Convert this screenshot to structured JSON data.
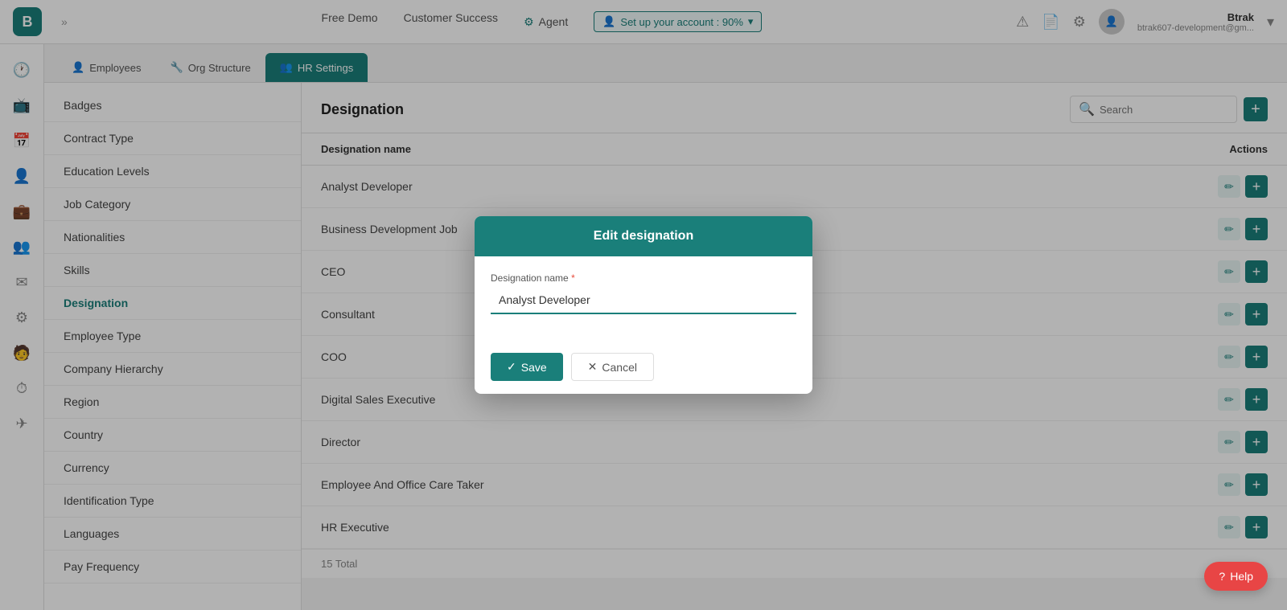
{
  "navbar": {
    "logo_text": "B",
    "chevron": "»",
    "links": [
      {
        "label": "Free Demo"
      },
      {
        "label": "Customer Success"
      },
      {
        "label": "Agent",
        "has_icon": true
      },
      {
        "label": "Set up your account : 90%",
        "has_icon": true,
        "has_chevron": true
      }
    ],
    "user": {
      "name": "Btrak",
      "email": "btrak607-development@gm..."
    }
  },
  "tabs": [
    {
      "label": "Employees",
      "icon": "👤",
      "active": false
    },
    {
      "label": "Org Structure",
      "icon": "🔧",
      "active": false
    },
    {
      "label": "HR Settings",
      "icon": "👥",
      "active": true
    }
  ],
  "sidebar_icons": [
    {
      "name": "clock-icon",
      "symbol": "🕐"
    },
    {
      "name": "tv-icon",
      "symbol": "📺"
    },
    {
      "name": "calendar-icon",
      "symbol": "📅"
    },
    {
      "name": "person-icon",
      "symbol": "👤"
    },
    {
      "name": "briefcase-icon",
      "symbol": "💼"
    },
    {
      "name": "people-icon",
      "symbol": "👥"
    },
    {
      "name": "mail-icon",
      "symbol": "✉"
    },
    {
      "name": "settings-icon",
      "symbol": "⚙"
    },
    {
      "name": "user2-icon",
      "symbol": "🧑"
    },
    {
      "name": "timer-icon",
      "symbol": "⏱"
    },
    {
      "name": "send-icon",
      "symbol": "✈"
    }
  ],
  "left_menu": {
    "items": [
      {
        "label": "Badges",
        "active": false
      },
      {
        "label": "Contract Type",
        "active": false
      },
      {
        "label": "Education Levels",
        "active": false
      },
      {
        "label": "Job Category",
        "active": false
      },
      {
        "label": "Nationalities",
        "active": false
      },
      {
        "label": "Skills",
        "active": false
      },
      {
        "label": "Designation",
        "active": true
      },
      {
        "label": "Employee Type",
        "active": false
      },
      {
        "label": "Company Hierarchy",
        "active": false
      },
      {
        "label": "Region",
        "active": false
      },
      {
        "label": "Country",
        "active": false
      },
      {
        "label": "Currency",
        "active": false
      },
      {
        "label": "Identification Type",
        "active": false
      },
      {
        "label": "Languages",
        "active": false
      },
      {
        "label": "Pay Frequency",
        "active": false
      }
    ]
  },
  "main_content": {
    "title": "Designation",
    "search_placeholder": "Search",
    "table": {
      "col_name": "Designation name",
      "col_actions": "Actions",
      "rows": [
        {
          "name": "Analyst Developer"
        },
        {
          "name": "Business Development Job"
        },
        {
          "name": "CEO"
        },
        {
          "name": "Consultant"
        },
        {
          "name": "COO"
        },
        {
          "name": "Digital Sales Executive"
        },
        {
          "name": "Director"
        },
        {
          "name": "Employee And Office Care Taker"
        },
        {
          "name": "HR Executive"
        }
      ],
      "total": "15 Total"
    }
  },
  "modal": {
    "title": "Edit designation",
    "field_label": "Designation name",
    "field_required": true,
    "field_value": "Analyst Developer",
    "save_label": "Save",
    "cancel_label": "Cancel"
  },
  "help": {
    "label": "Help"
  },
  "colors": {
    "primary": "#1a7f7a",
    "danger": "#e84545"
  }
}
